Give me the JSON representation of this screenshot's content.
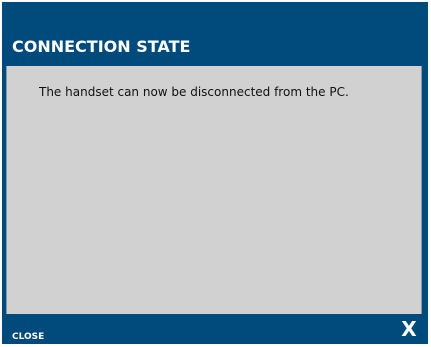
{
  "dialog": {
    "title": "CONNECTION STATE",
    "message": "The handset can now be disconnected from the PC.",
    "footer": {
      "close_label": "CLOSE",
      "close_glyph": "X",
      "close_icon": "close-icon"
    }
  },
  "colors": {
    "frame": "#004a7c",
    "panel": "#d1d1d1",
    "title_text": "#ffffff",
    "message_text": "#111111"
  }
}
